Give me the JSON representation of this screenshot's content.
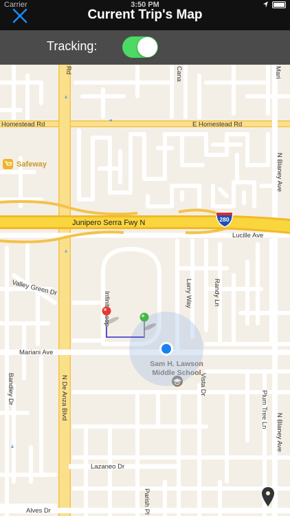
{
  "status_bar": {
    "carrier": "Carrier",
    "time": "3:50 PM"
  },
  "nav": {
    "title": "Current Trip's Map",
    "close_icon": "close-x-icon"
  },
  "tracking": {
    "label": "Tracking:",
    "enabled": true
  },
  "map": {
    "roads": {
      "homestead_west": "Homestead Rd",
      "homestead_east": "E Homestead Rd",
      "rd_top": "Rd",
      "canal": "Cana",
      "mari": "Mari",
      "junipero": "Junipero Serra Fwy N",
      "interstate": "280",
      "lucille": "Lucille Ave",
      "valley_green": "Valley Green Dr",
      "infinite_loop": "Infinite Loop",
      "larry_way": "Larry Way",
      "randy_ln": "Randy Ln",
      "blaney_top": "N Blaney Ave",
      "blaney_bottom": "N Blaney Ave",
      "mariani": "Mariani Ave",
      "de_anza": "N De Anza Blvd",
      "bandley": "Bandley Dr",
      "vista": "Vista Dr",
      "plum_tree": "Plum Tree Ln",
      "lazaneo": "Lazaneo Dr",
      "parish": "Parish Pl",
      "alves": "Alves Dr"
    },
    "pois": {
      "safeway": "Safeway",
      "school_line1": "Sam H. Lawson",
      "school_line2": "Middle School"
    },
    "colors": {
      "route": "#2c2cc8",
      "user_dot": "#1a82f0",
      "start_pin": "#e53935",
      "end_pin": "#43b649",
      "freeway": "#f6cf3c",
      "arterial": "#fbdc7e"
    }
  }
}
